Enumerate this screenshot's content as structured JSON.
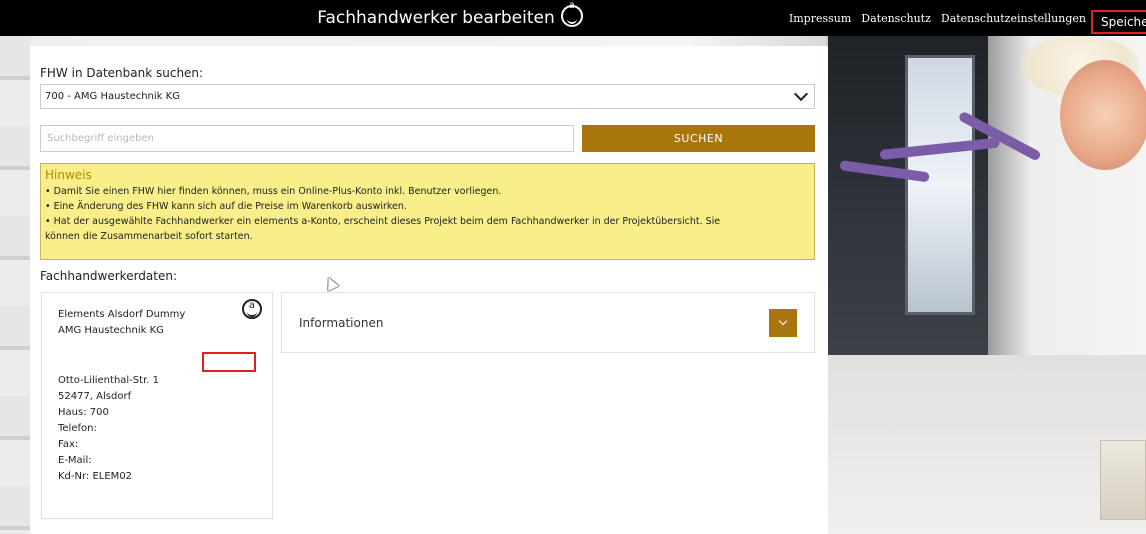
{
  "header": {
    "title": "Fachhandwerker bearbeiten",
    "links": [
      "Impressum",
      "Datenschutz",
      "Datenschutzeinstellungen"
    ],
    "save_label": "Speichern"
  },
  "search_section": {
    "label": "FHW in Datenbank suchen:",
    "selected": "700 - AMG Haustechnik KG",
    "search_placeholder": "Suchbegriff eingeben",
    "search_button": "SUCHEN"
  },
  "hint": {
    "title": "Hinweis",
    "lines": [
      "• Damit Sie einen FHW hier finden können, muss ein Online-Plus-Konto inkl. Benutzer vorliegen.",
      "• Eine Änderung des FHW kann sich auf die Preise im Warenkorb auswirken.",
      "• Hat der ausgewählte Fachhandwerker ein elements a-Konto, erscheint dieses Projekt beim dem Fachhandwerker in der Projektübersicht. Sie",
      "können die Zusammenarbeit sofort starten."
    ]
  },
  "craftsman": {
    "section_label": "Fachhandwerkerdaten:",
    "name1": "Elements Alsdorf Dummy",
    "name2": "AMG Haustechnik KG",
    "street": "Otto-Lilienthal-Str. 1",
    "city": "52477, Alsdorf",
    "house": "Haus: 700",
    "phone": "Telefon:",
    "fax": "Fax:",
    "email": "E-Mail:",
    "customer_no": "Kd-Nr: ELEM02"
  },
  "info_panel": {
    "title": "Informationen"
  },
  "colors": {
    "accent": "#a9750d",
    "hint_bg": "#f8ef8a",
    "highlight": "#e02020"
  }
}
